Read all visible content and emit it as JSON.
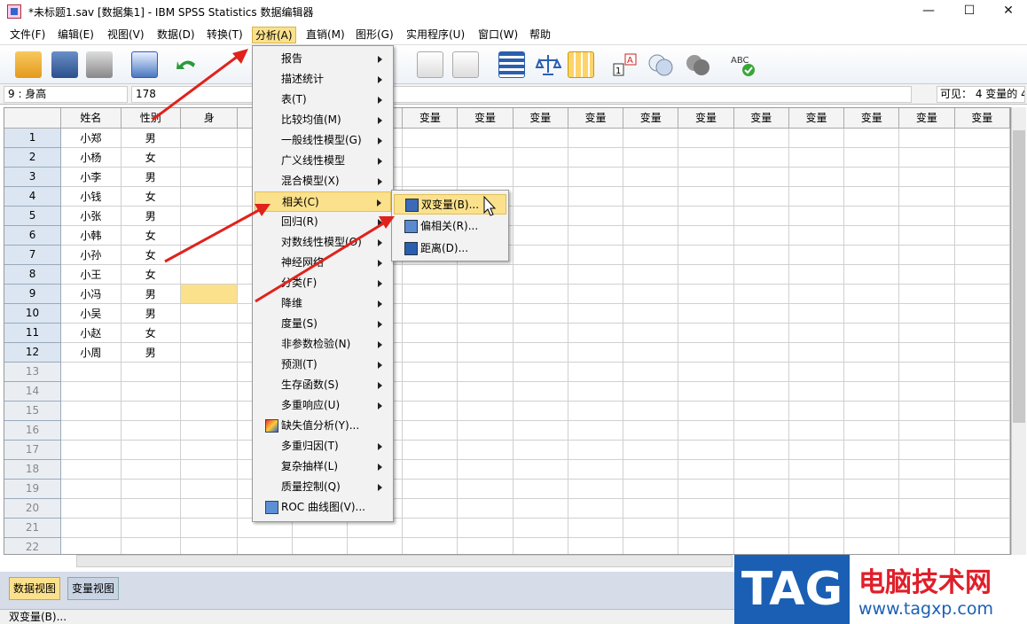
{
  "window": {
    "title": "*未标题1.sav [数据集1] - IBM SPSS Statistics 数据编辑器",
    "minimize": "—",
    "maximize": "☐",
    "close": "✕"
  },
  "menubar": [
    "文件(F)",
    "编辑(E)",
    "视图(V)",
    "数据(D)",
    "转换(T)",
    "分析(A)",
    "直销(M)",
    "图形(G)",
    "实用程序(U)",
    "窗口(W)",
    "帮助"
  ],
  "cellbar": {
    "ref": "9 : 身高",
    "value": "178",
    "visible": "可见：  4 变量的 4"
  },
  "columns": [
    "姓名",
    "性别",
    "身",
    "",
    "变量",
    "变量",
    "变量",
    "变量",
    "变量",
    "变量",
    "变量",
    "变量",
    "变量",
    "变量",
    "变量",
    "变量",
    "变量"
  ],
  "rows": [
    {
      "n": "1",
      "name": "小郑",
      "sex": "男"
    },
    {
      "n": "2",
      "name": "小杨",
      "sex": "女"
    },
    {
      "n": "3",
      "name": "小李",
      "sex": "男"
    },
    {
      "n": "4",
      "name": "小钱",
      "sex": "女"
    },
    {
      "n": "5",
      "name": "小张",
      "sex": "男"
    },
    {
      "n": "6",
      "name": "小韩",
      "sex": "女"
    },
    {
      "n": "7",
      "name": "小孙",
      "sex": "女"
    },
    {
      "n": "8",
      "name": "小王",
      "sex": "女"
    },
    {
      "n": "9",
      "name": "小冯",
      "sex": "男"
    },
    {
      "n": "10",
      "name": "小吴",
      "sex": "男"
    },
    {
      "n": "11",
      "name": "小赵",
      "sex": "女"
    },
    {
      "n": "12",
      "name": "小周",
      "sex": "男"
    }
  ],
  "empty_rows": [
    "13",
    "14",
    "15",
    "16",
    "17",
    "18",
    "19",
    "20",
    "21",
    "22"
  ],
  "analyze_menu": [
    "报告",
    "描述统计",
    "表(T)",
    "比较均值(M)",
    "一般线性模型(G)",
    "广义线性模型",
    "混合模型(X)",
    "相关(C)",
    "回归(R)",
    "对数线性模型(O)",
    "神经网络",
    "分类(F)",
    "降维",
    "度量(S)",
    "非参数检验(N)",
    "预测(T)",
    "生存函数(S)",
    "多重响应(U)",
    "缺失值分析(Y)...",
    "多重归因(T)",
    "复杂抽样(L)",
    "质量控制(Q)",
    "ROC 曲线图(V)..."
  ],
  "correlate_submenu": [
    "双变量(B)...",
    "偏相关(R)...",
    "距离(D)..."
  ],
  "tabs": {
    "data_view": "数据视图",
    "variable_view": "变量视图"
  },
  "status": "双变量(B)...",
  "logo": {
    "tag": "TAG",
    "name": "电脑技术网",
    "url": "www.tagxp.com"
  },
  "colors": {
    "highlight": "#fbe18c",
    "arrow": "#e0221c",
    "logo_blue": "#1a5fb4",
    "logo_red": "#e01f2a"
  }
}
